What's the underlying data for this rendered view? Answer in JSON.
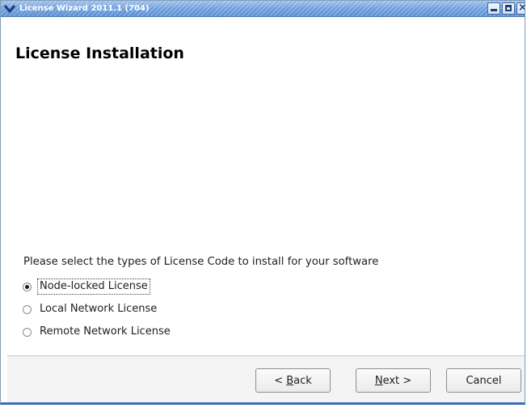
{
  "window": {
    "title": "License Wizard 2011.1 (704)",
    "controls": [
      "minimize-icon",
      "maximize-icon",
      "close-icon"
    ]
  },
  "page": {
    "heading": "License Installation",
    "prompt": "Please select the types of License Code to install for your software"
  },
  "license_types": [
    {
      "label": "Node-locked License",
      "selected": true
    },
    {
      "label": "Local Network License",
      "selected": false
    },
    {
      "label": "Remote Network License",
      "selected": false
    }
  ],
  "buttons": {
    "back": {
      "prefix": "< ",
      "mnemonic": "B",
      "rest": "ack"
    },
    "next": {
      "mnemonic": "N",
      "rest": "ext >"
    },
    "cancel": "Cancel"
  },
  "colors": {
    "titlebar": "#6f9fdc",
    "title_text": "#ffffff"
  }
}
